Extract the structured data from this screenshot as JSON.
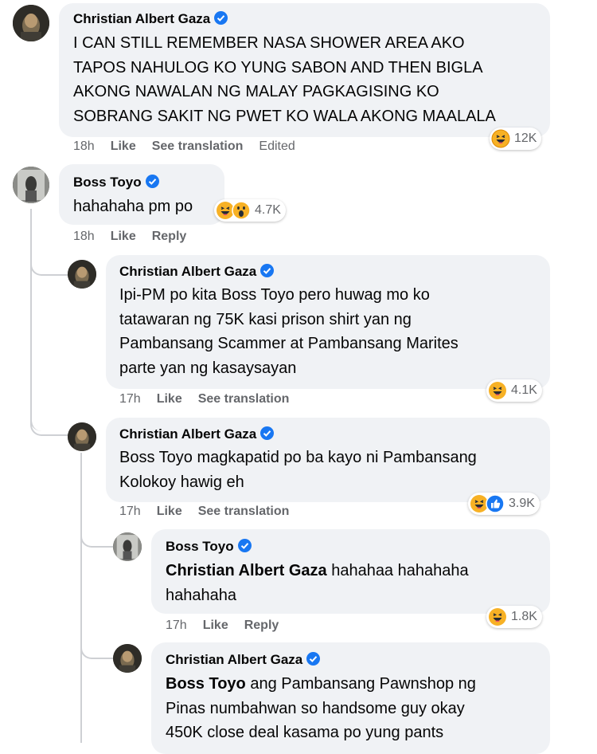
{
  "comments": [
    {
      "author": "Christian Albert Gaza",
      "lines": [
        "I CAN STILL REMEMBER NASA SHOWER AREA AKO",
        "TAPOS NAHULOG KO YUNG SABON AND THEN BIGLA",
        "AKONG NAWALAN NG MALAY PAGKAGISING KO",
        "SOBRANG SAKIT NG PWET KO WALA AKONG MAALALA"
      ],
      "time": "18h",
      "like": "Like",
      "action": "See translation",
      "extra": "Edited",
      "reactions": [
        "haha"
      ],
      "count": "12K"
    },
    {
      "author": "Boss Toyo",
      "lines": [
        "hahahaha pm po"
      ],
      "time": "18h",
      "like": "Like",
      "action": "Reply",
      "reactions": [
        "haha",
        "wow"
      ],
      "count": "4.7K"
    },
    {
      "author": "Christian Albert Gaza",
      "lines": [
        "Ipi-PM po kita Boss Toyo pero huwag mo ko",
        "tatawaran ng 75K kasi prison shirt yan ng",
        "Pambansang Scammer at Pambansang Marites",
        "parte yan ng kasaysayan"
      ],
      "time": "17h",
      "like": "Like",
      "action": "See translation",
      "reactions": [
        "haha"
      ],
      "count": "4.1K"
    },
    {
      "author": "Christian Albert Gaza",
      "lines": [
        "Boss Toyo magkapatid po ba kayo ni Pambansang",
        "Kolokoy hawig eh"
      ],
      "time": "17h",
      "like": "Like",
      "action": "See translation",
      "reactions": [
        "haha",
        "like"
      ],
      "count": "3.9K"
    },
    {
      "author": "Boss Toyo",
      "mention": "Christian Albert Gaza",
      "line1_rest": " hahahaa hahahaha",
      "line2": "hahahaha",
      "time": "17h",
      "like": "Like",
      "action": "Reply",
      "reactions": [
        "haha"
      ],
      "count": "1.8K"
    },
    {
      "author": "Christian Albert Gaza",
      "mention": "Boss Toyo",
      "line1_rest": " ang Pambansang Pawnshop ng",
      "line2": "Pinas numbahwan so handsome guy okay",
      "line3": "450K close deal kasama po yung pants"
    }
  ],
  "colors": {
    "bubble": "#f0f2f5",
    "verified": "#1877f2",
    "meta": "#65676b",
    "thread": "#ced0d4"
  }
}
